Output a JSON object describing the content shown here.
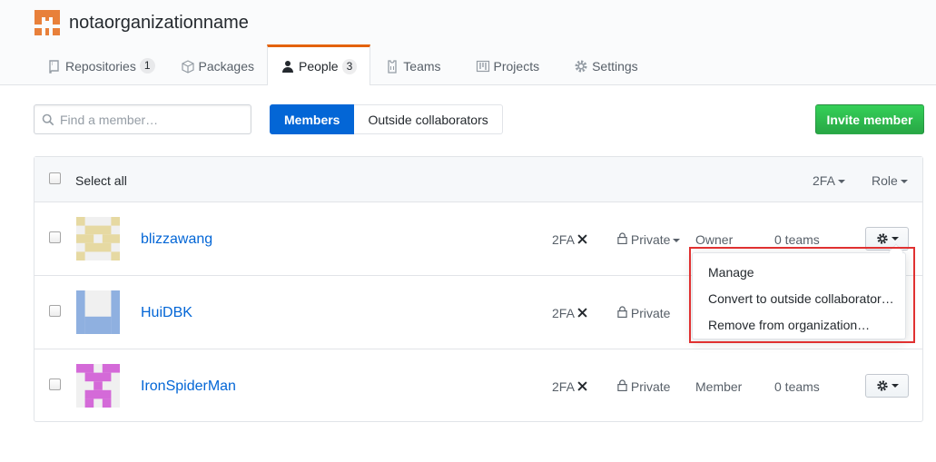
{
  "org": {
    "name": "notaorganizationname",
    "avatar_color": "#e8803a"
  },
  "tabs": [
    {
      "label": "Repositories",
      "icon": "repo-icon",
      "count": "1"
    },
    {
      "label": "Packages",
      "icon": "package-icon"
    },
    {
      "label": "People",
      "icon": "person-icon",
      "count": "3",
      "selected": true
    },
    {
      "label": "Teams",
      "icon": "jersey-icon"
    },
    {
      "label": "Projects",
      "icon": "project-icon"
    },
    {
      "label": "Settings",
      "icon": "gear-icon"
    }
  ],
  "search": {
    "placeholder": "Find a member…"
  },
  "filter": {
    "members_label": "Members",
    "outside_label": "Outside collaborators"
  },
  "invite": {
    "label": "Invite member"
  },
  "table": {
    "select_all": "Select all",
    "tfa_filter": "2FA",
    "role_filter": "Role"
  },
  "members": [
    {
      "username": "blizzawang",
      "tfa": "2FA",
      "visibility": "Private",
      "role": "Owner",
      "teams": "0 teams",
      "avatar_color": "#e6d9a2"
    },
    {
      "username": "HuiDBK",
      "tfa": "2FA",
      "visibility": "Private",
      "role": "",
      "teams": "",
      "avatar_color": "#8fb0e0"
    },
    {
      "username": "IronSpiderMan",
      "tfa": "2FA",
      "visibility": "Private",
      "role": "Member",
      "teams": "0 teams",
      "avatar_color": "#d46ad8"
    }
  ],
  "dropdown": {
    "items": [
      "Manage",
      "Convert to outside collaborator…",
      "Remove from organization…"
    ]
  },
  "colors": {
    "accent": "#0366d6",
    "tab_accent": "#e36209",
    "invite_green": "#28a745",
    "highlight": "#e03131"
  }
}
